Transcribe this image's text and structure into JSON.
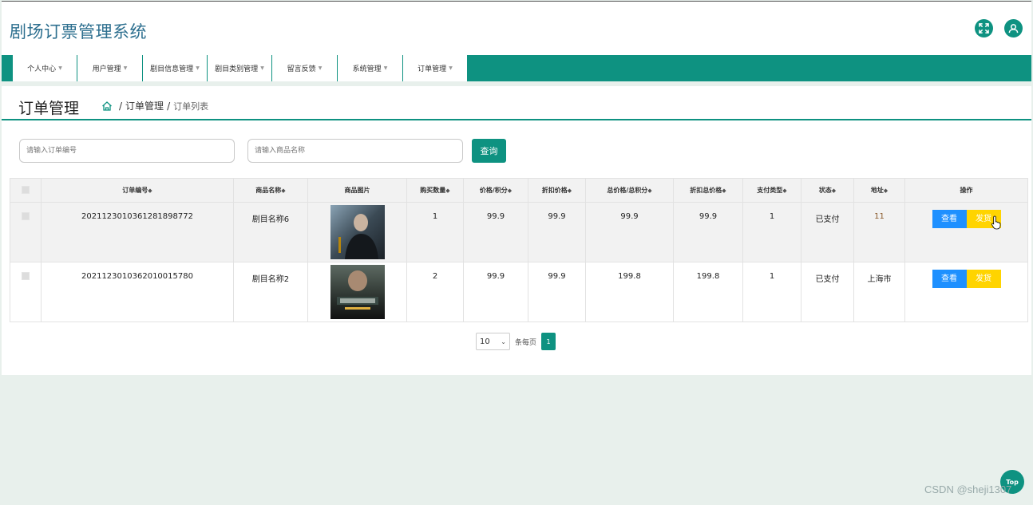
{
  "app_title": "剧场订票管理系统",
  "header_icons": {
    "fullscreen": "fullscreen-icon",
    "user": "user-icon"
  },
  "nav": [
    {
      "label": "个人中心"
    },
    {
      "label": "用户管理"
    },
    {
      "label": "剧目信息管理"
    },
    {
      "label": "剧目类别管理"
    },
    {
      "label": "留言反馈"
    },
    {
      "label": "系统管理"
    },
    {
      "label": "订单管理"
    }
  ],
  "page": {
    "title": "订单管理",
    "breadcrumb": {
      "section": "订单管理",
      "current": "订单列表"
    }
  },
  "search": {
    "order_no_placeholder": "请输入订单编号",
    "product_name_placeholder": "请输入商品名称",
    "query_label": "查询"
  },
  "table": {
    "sort_symbol": "◆",
    "columns": {
      "order_no": "订单编号",
      "product_name": "商品名称",
      "product_image": "商品图片",
      "quantity": "购买数量",
      "price_points": "价格/积分",
      "discount_price": "折扣价格",
      "total_price_points": "总价格/总积分",
      "discount_total": "折扣总价格",
      "pay_type": "支付类型",
      "status": "状态",
      "address": "地址",
      "actions": "操作"
    },
    "rows": [
      {
        "order_no": "2021123010361281898772",
        "product_name": "剧目名称6",
        "quantity": "1",
        "price_points": "99.9",
        "discount_price": "99.9",
        "total_price_points": "99.9",
        "discount_total": "99.9",
        "pay_type": "1",
        "status": "已支付",
        "address": "11"
      },
      {
        "order_no": "20211230103620100157​80",
        "product_name": "剧目名称2",
        "quantity": "2",
        "price_points": "99.9",
        "discount_price": "99.9",
        "total_price_points": "199.8",
        "discount_total": "199.8",
        "pay_type": "1",
        "status": "已支付",
        "address": "上海市"
      }
    ],
    "actions": {
      "view": "查看",
      "ship": "发货"
    }
  },
  "pager": {
    "page_size": "10",
    "per_page_label": "条每页",
    "current_page": "1"
  },
  "top_button": "Top",
  "watermark": "CSDN @sheji1307",
  "colors": {
    "primary": "#0e9281",
    "view": "#1e90ff",
    "ship": "#ffd400",
    "title": "#2d6f8f"
  }
}
